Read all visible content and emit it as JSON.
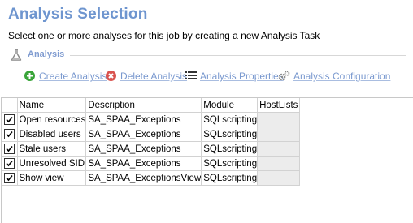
{
  "header": {
    "title": "Analysis Selection",
    "subtitle": "Select one or more analyses for this job by creating a new Analysis Task"
  },
  "group": {
    "label": "Analysis",
    "icon": "flask-icon"
  },
  "toolbar": {
    "create": {
      "label": "Create Analysis",
      "icon": "add-icon",
      "color": "#3aa53a"
    },
    "delete": {
      "label": "Delete Analysis",
      "icon": "delete-icon",
      "color": "#d9534f"
    },
    "properties": {
      "label": "Analysis Properties",
      "icon": "list-icon"
    },
    "configuration": {
      "label": "Analysis Configuration",
      "icon": "gears-icon"
    }
  },
  "table": {
    "columns": {
      "name": "Name",
      "description": "Description",
      "module": "Module",
      "hostlists": "HostLists"
    },
    "rows": [
      {
        "checked": true,
        "name": "Open resources",
        "description": "SA_SPAA_Exceptions",
        "module": "SQLscripting",
        "hostlists": ""
      },
      {
        "checked": true,
        "name": "Disabled users",
        "description": "SA_SPAA_Exceptions",
        "module": "SQLscripting",
        "hostlists": ""
      },
      {
        "checked": true,
        "name": "Stale users",
        "description": "SA_SPAA_Exceptions",
        "module": "SQLscripting",
        "hostlists": ""
      },
      {
        "checked": true,
        "name": "Unresolved SID",
        "description": "SA_SPAA_Exceptions",
        "module": "SQLscripting",
        "hostlists": ""
      },
      {
        "checked": true,
        "name": "Show view",
        "description": "SA_SPAA_ExceptionsView",
        "module": "SQLscripting",
        "hostlists": ""
      }
    ]
  }
}
